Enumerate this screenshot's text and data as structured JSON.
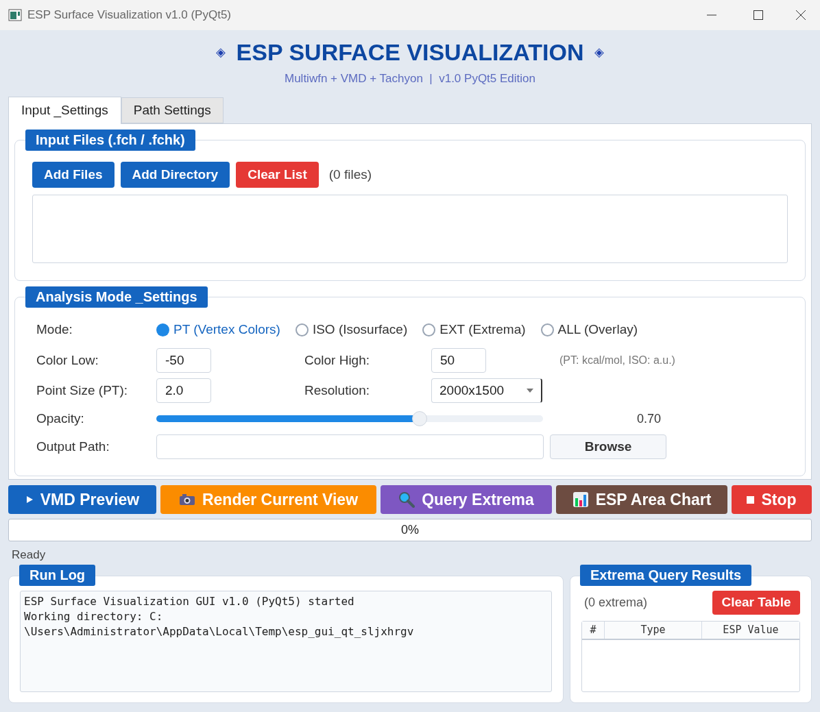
{
  "window": {
    "title": "ESP Surface Visualization v1.0 (PyQt5)"
  },
  "header": {
    "title": "ESP SURFACE VISUALIZATION",
    "left_mark": "◈",
    "right_mark": "◈",
    "subtitle": "Multiwfn + VMD + Tachyon  |  v1.0 PyQt5 Edition"
  },
  "tabs": [
    {
      "label": "Input _Settings",
      "selected": true
    },
    {
      "label": "Path Settings",
      "selected": false
    }
  ],
  "input_files": {
    "title": "Input Files (.fch / .fchk)",
    "buttons": [
      {
        "label": "Add Files",
        "kind": "primary"
      },
      {
        "label": "Add Directory",
        "kind": "primary"
      },
      {
        "label": "Clear List",
        "kind": "danger"
      }
    ],
    "count": "(0 files)"
  },
  "analysis": {
    "title": "Analysis Mode _Settings",
    "mode_label": "Mode:",
    "modes": [
      {
        "label": "PT (Vertex Colors)",
        "selected": true
      },
      {
        "label": "ISO (Isosurface)",
        "selected": false
      },
      {
        "label": "EXT (Extrema)",
        "selected": false
      },
      {
        "label": "ALL (Overlay)",
        "selected": false
      }
    ],
    "color_low_label": "Color Low:",
    "color_low": "-50",
    "color_high_label": "Color High:",
    "color_high": "50",
    "units_note": "(PT: kcal/mol, ISO: a.u.)",
    "point_size_label": "Point Size (PT):",
    "point_size": "2.0",
    "resolution_label": "Resolution:",
    "resolution": "2000x1500",
    "opacity_label": "Opacity:",
    "opacity": {
      "level": 0.68
    },
    "opacity_reading": "0.70",
    "output_label": "Output Path:",
    "browse": "Browse"
  },
  "actions": [
    {
      "label": "VMD Preview",
      "kind": "play",
      "color": "#1565c0"
    },
    {
      "label": "Render Current View",
      "kind": "camera",
      "color": "#fb8c00"
    },
    {
      "label": "Query Extrema",
      "kind": "search",
      "color": "#7e57c2"
    },
    {
      "label": "ESP Area Chart",
      "kind": "chart",
      "color": "#6d4c41"
    },
    {
      "label": "Stop",
      "kind": "stop",
      "color": "#e53935"
    }
  ],
  "progress": {
    "level": 0,
    "text": "0%"
  },
  "status": "Ready",
  "run_log": {
    "title": "Run Log",
    "lines": [
      "ESP Surface Visualization GUI v1.0 (PyQt5) started",
      "Working directory: C:",
      "\\Users\\Administrator\\AppData\\Local\\Temp\\esp_gui_qt_sljxhrgv"
    ]
  },
  "extrema": {
    "title": "Extrema Query Results",
    "count": "(0 extrema)",
    "clear": "Clear Table",
    "columns": [
      "#",
      "Type",
      "ESP Value"
    ]
  }
}
